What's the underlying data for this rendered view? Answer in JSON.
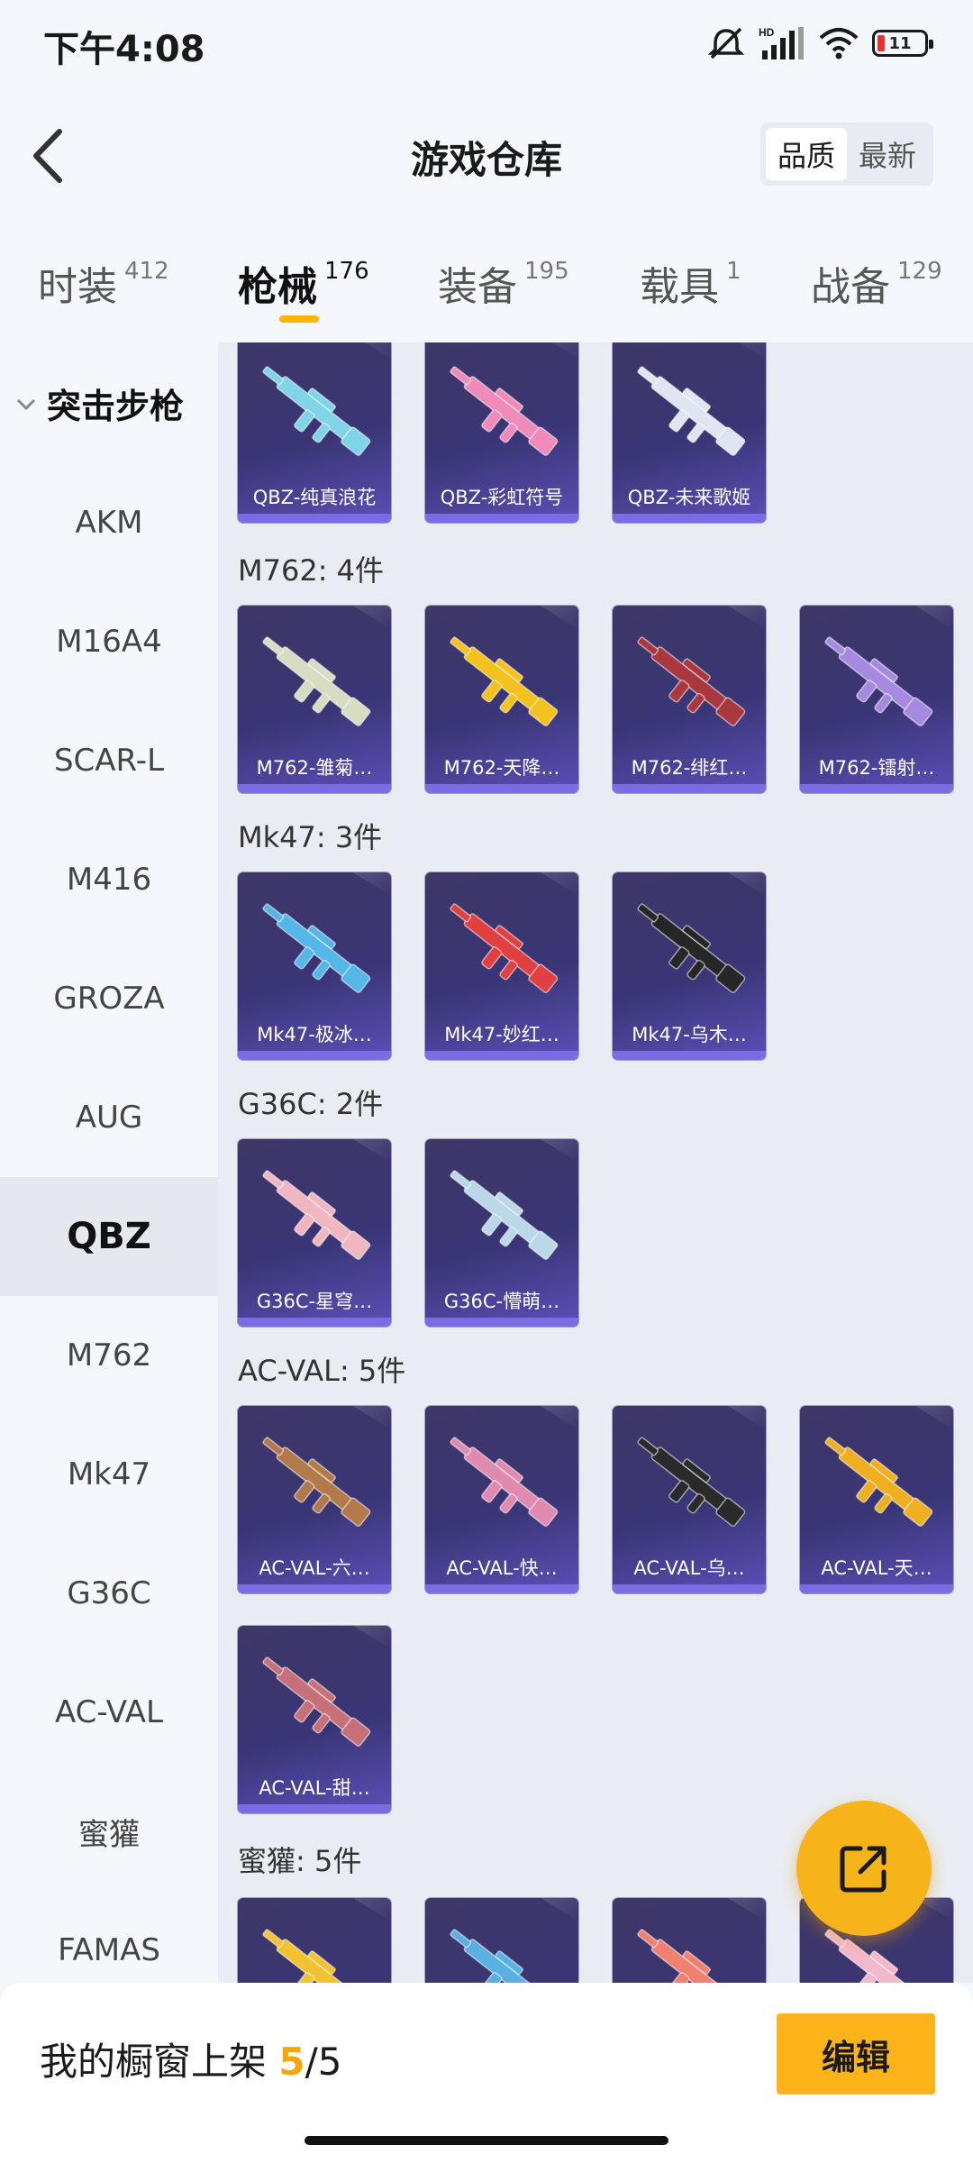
{
  "status": {
    "time": "下午4:08",
    "battery": "11"
  },
  "header": {
    "title": "游戏仓库",
    "sort_options": [
      "品质",
      "最新"
    ]
  },
  "tabs": [
    {
      "label": "时装",
      "count": "412"
    },
    {
      "label": "枪械",
      "count": "176"
    },
    {
      "label": "装备",
      "count": "195"
    },
    {
      "label": "载具",
      "count": "1"
    },
    {
      "label": "战备",
      "count": "129"
    }
  ],
  "sidebar": {
    "category": "突击步枪",
    "items": [
      "AKM",
      "M16A4",
      "SCAR-L",
      "M416",
      "GROZA",
      "AUG",
      "QBZ",
      "M762",
      "Mk47",
      "G36C",
      "AC-VAL",
      "蜜獾",
      "FAMAS"
    ]
  },
  "sections": [
    {
      "title": "",
      "items": [
        "QBZ-纯真浪花",
        "QBZ-彩虹符号",
        "QBZ-未来歌姬"
      ]
    },
    {
      "title": "M762: 4件",
      "items": [
        "M762-雏菊…",
        "M762-天降…",
        "M762-绯红…",
        "M762-镭射…"
      ]
    },
    {
      "title": "Mk47: 3件",
      "items": [
        "Mk47-极冰…",
        "Mk47-妙红…",
        "Mk47-乌木…"
      ]
    },
    {
      "title": "G36C: 2件",
      "items": [
        "G36C-星穹…",
        "G36C-懵萌…"
      ]
    },
    {
      "title": "AC-VAL: 5件",
      "items": [
        "AC-VAL-六…",
        "AC-VAL-快…",
        "AC-VAL-乌…",
        "AC-VAL-天…",
        "AC-VAL-甜…"
      ]
    },
    {
      "title": "蜜獾: 5件",
      "items": [
        "",
        "",
        "",
        ""
      ]
    }
  ],
  "bottom": {
    "label": "我的橱窗上架",
    "current": "5",
    "separator": "/",
    "total": "5",
    "edit_label": "编辑"
  },
  "colors": {
    "accent": "#ffb31a",
    "card_bg": "#3a3575",
    "card_bar": "#7b6ce4"
  }
}
